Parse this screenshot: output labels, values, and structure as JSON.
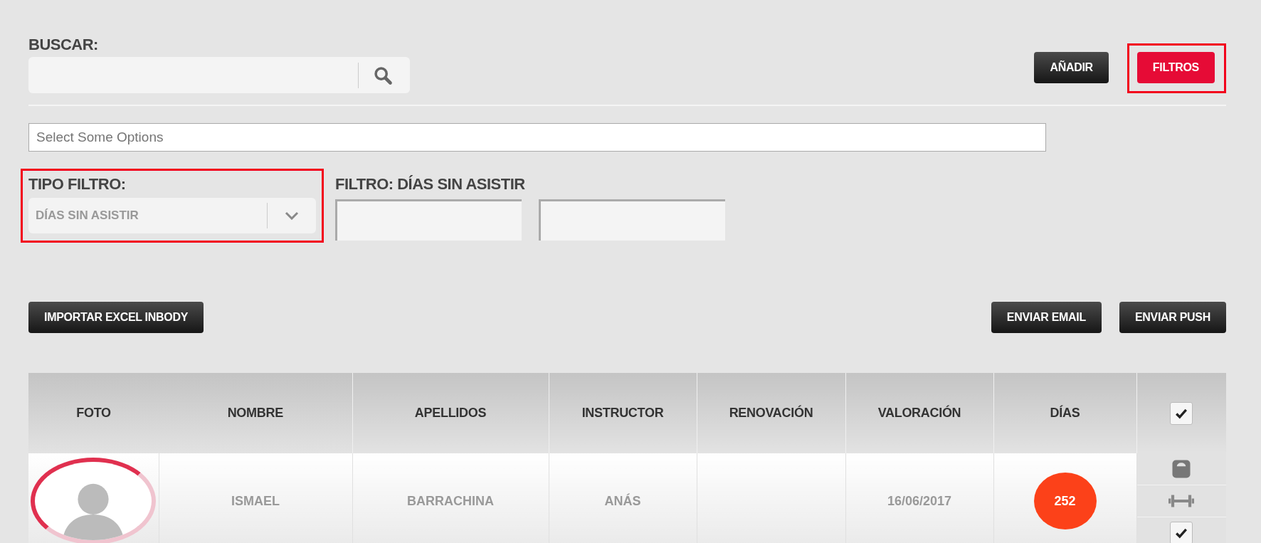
{
  "search": {
    "label": "BUSCAR:"
  },
  "toolbar_buttons": [
    {
      "label": "AÑADIR",
      "kind": "dark",
      "highlighted": false
    },
    {
      "label": "FILTROS",
      "kind": "primary",
      "highlighted": true
    }
  ],
  "options_field": {
    "placeholder": "Select Some Options"
  },
  "filter_type": {
    "label": "TIPO FILTRO:",
    "value": "DÍAS SIN ASISTIR",
    "highlighted": true
  },
  "filter_range": {
    "label": "FILTRO: DÍAS SIN ASISTIR"
  },
  "actions_left": [
    {
      "label": "IMPORTAR EXCEL INBODY"
    }
  ],
  "actions_right": [
    {
      "label": "ENVIAR EMAIL"
    },
    {
      "label": "ENVIAR PUSH"
    }
  ],
  "table": {
    "columns": [
      "FOTO",
      "NOMBRE",
      "APELLIDOS",
      "INSTRUCTOR",
      "RENOVACIÓN",
      "VALORACIÓN",
      "DÍAS"
    ],
    "select_all": {
      "checked": true
    },
    "rows": [
      {
        "nombre": "ISMAEL",
        "apellidos": "BARRACHINA",
        "instructor": "ANÁS",
        "valoracion": "16/06/2017",
        "dias": "252",
        "checked": true
      }
    ]
  }
}
